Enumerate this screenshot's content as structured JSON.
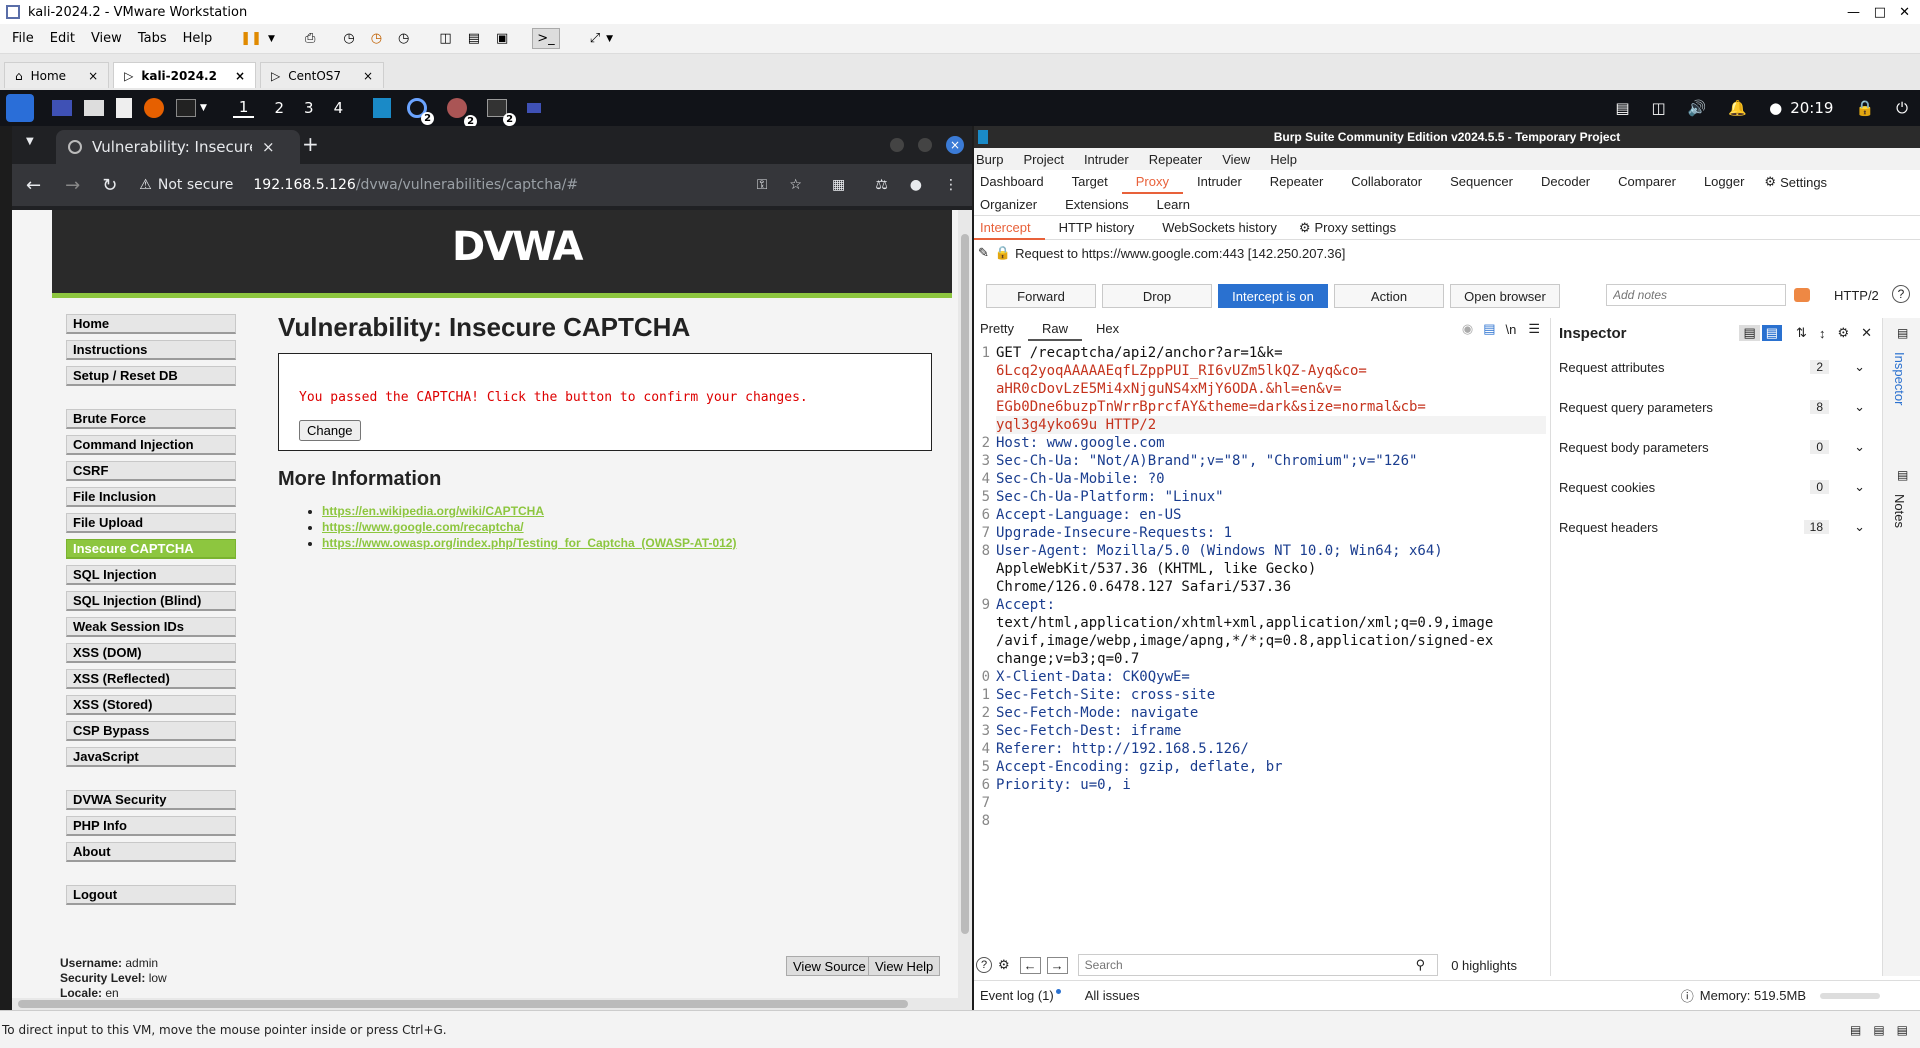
{
  "vmware": {
    "title": "kali-2024.2 - VMware Workstation",
    "menu": [
      "File",
      "Edit",
      "View",
      "Tabs",
      "Help"
    ],
    "tabs": [
      {
        "label": "Home",
        "active": false
      },
      {
        "label": "kali-2024.2",
        "active": true
      },
      {
        "label": "CentOS7",
        "active": false
      }
    ],
    "status_hint": "To direct input to this VM, move the mouse pointer inside or press Ctrl+G."
  },
  "kali_panel": {
    "workspaces": [
      "1",
      "2",
      "3",
      "4"
    ],
    "badges": [
      "2",
      "2",
      "2"
    ],
    "time": "20:19"
  },
  "chrome": {
    "tab_title": "Vulnerability: Insecure C/",
    "security_label": "Not secure",
    "url_host": "192.168.5.126",
    "url_path": "/dvwa/vulnerabilities/captcha/#"
  },
  "dvwa": {
    "logo": "DVWA",
    "page_title": "Vulnerability: Insecure CAPTCHA",
    "message": "You passed the CAPTCHA! Click the button to confirm your changes.",
    "change_label": "Change",
    "more_info_heading": "More Information",
    "links": [
      "https://en.wikipedia.org/wiki/CAPTCHA",
      "https://www.google.com/recaptcha/",
      "https://www.owasp.org/index.php/Testing_for_Captcha_(OWASP-AT-012)"
    ],
    "menu_groups": [
      [
        "Home",
        "Instructions",
        "Setup / Reset DB"
      ],
      [
        "Brute Force",
        "Command Injection",
        "CSRF",
        "File Inclusion",
        "File Upload",
        "Insecure CAPTCHA",
        "SQL Injection",
        "SQL Injection (Blind)",
        "Weak Session IDs",
        "XSS (DOM)",
        "XSS (Reflected)",
        "XSS (Stored)",
        "CSP Bypass",
        "JavaScript"
      ],
      [
        "DVWA Security",
        "PHP Info",
        "About"
      ],
      [
        "Logout"
      ]
    ],
    "active_item": "Insecure CAPTCHA",
    "username_label": "Username:",
    "username": "admin",
    "security_label": "Security Level:",
    "security": "low",
    "locale_label": "Locale:",
    "locale": "en",
    "view_source": "View Source",
    "view_help": "View Help"
  },
  "burp": {
    "title": "Burp Suite Community Edition v2024.5.5 - Temporary Project",
    "menu": [
      "Burp",
      "Project",
      "Intruder",
      "Repeater",
      "View",
      "Help"
    ],
    "tabs_row1": [
      "Dashboard",
      "Target",
      "Proxy",
      "Intruder",
      "Repeater",
      "Collaborator",
      "Sequencer",
      "Decoder",
      "Comparer",
      "Logger"
    ],
    "settings_label": "Settings",
    "tabs_row2": [
      "Organizer",
      "Extensions",
      "Learn"
    ],
    "active_tab": "Proxy",
    "subtabs": [
      "Intercept",
      "HTTP history",
      "WebSockets history"
    ],
    "proxy_settings": "Proxy settings",
    "request_to": "Request to https://www.google.com:443  [142.250.207.36]",
    "buttons": {
      "forward": "Forward",
      "drop": "Drop",
      "intercept": "Intercept is on",
      "action": "Action",
      "open_browser": "Open browser"
    },
    "add_notes_placeholder": "Add notes",
    "http_version": "HTTP/2",
    "view_tabs": [
      "Pretty",
      "Raw",
      "Hex"
    ],
    "newline_toggle": "\\n",
    "line_numbers": [
      "1",
      "2",
      "3",
      "4",
      "5",
      "6",
      "7",
      "8",
      "9",
      "0",
      "1",
      "2",
      "3",
      "4",
      "5",
      "6",
      "7",
      "8"
    ],
    "request_lines": [
      "GET /recaptcha/api2/anchor?ar=1&k=",
      "6Lcq2yoqAAAAAEqfLZppPUI_RI6vUZm5lkQZ-Ayq&co=",
      "aHR0cDovLzE5Mi4xNjguNS4xMjY6ODA.&hl=en&v=",
      "EGb0Dne6buzpTnWrrBprcfAY&theme=dark&size=normal&cb=",
      "yql3g4yko69u HTTP/2",
      "Host: www.google.com",
      "Sec-Ch-Ua: \"Not/A)Brand\";v=\"8\", \"Chromium\";v=\"126\"",
      "Sec-Ch-Ua-Mobile: ?0",
      "Sec-Ch-Ua-Platform: \"Linux\"",
      "Accept-Language: en-US",
      "Upgrade-Insecure-Requests: 1",
      "User-Agent: Mozilla/5.0 (Windows NT 10.0; Win64; x64)",
      "AppleWebKit/537.36 (KHTML, like Gecko)",
      "Chrome/126.0.6478.127 Safari/537.36",
      "Accept:",
      "text/html,application/xhtml+xml,application/xml;q=0.9,image",
      "/avif,image/webp,image/apng,*/*;q=0.8,application/signed-ex",
      "change;v=b3;q=0.7",
      "X-Client-Data: CK0QywE=",
      "Sec-Fetch-Site: cross-site",
      "Sec-Fetch-Mode: navigate",
      "Sec-Fetch-Dest: iframe",
      "Referer: http://192.168.5.126/",
      "Accept-Encoding: gzip, deflate, br",
      "Priority: u=0, i"
    ],
    "inspector_title": "Inspector",
    "inspector_rows": [
      {
        "label": "Request attributes",
        "count": "2"
      },
      {
        "label": "Request query parameters",
        "count": "8"
      },
      {
        "label": "Request body parameters",
        "count": "0"
      },
      {
        "label": "Request cookies",
        "count": "0"
      },
      {
        "label": "Request headers",
        "count": "18"
      }
    ],
    "side_tabs": [
      "Inspector",
      "Notes"
    ],
    "search_placeholder": "Search",
    "highlights": "0 highlights",
    "event_log": "Event log (1)",
    "all_issues": "All issues",
    "memory": "Memory: 519.5MB"
  }
}
